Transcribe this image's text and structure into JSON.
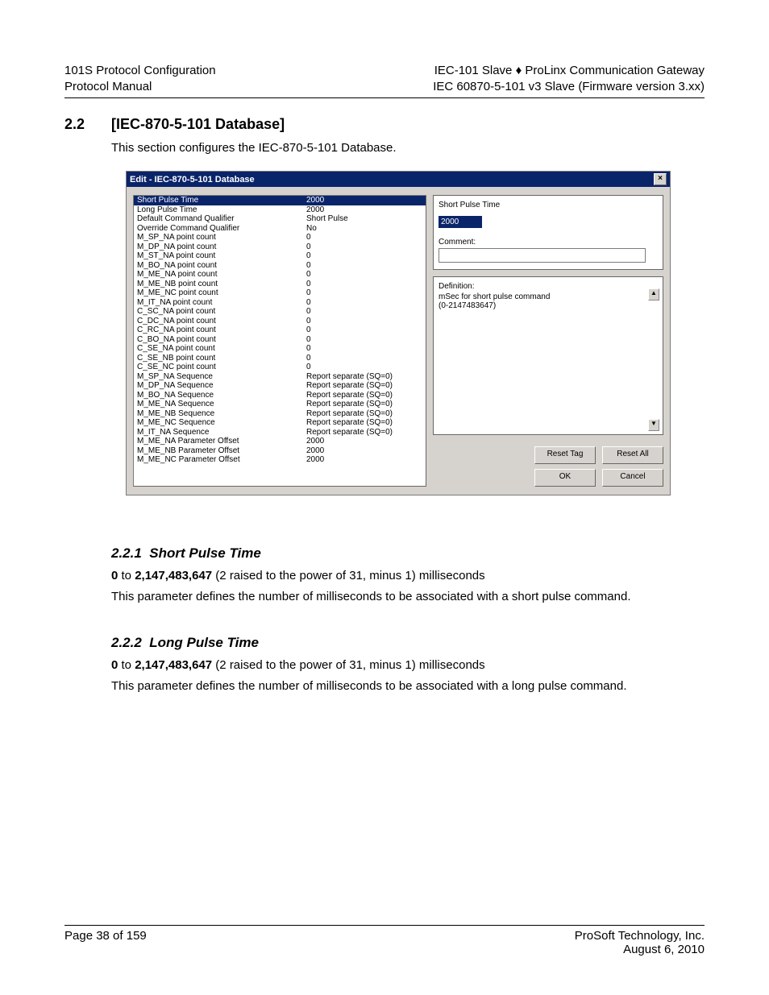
{
  "header": {
    "left1": "101S Protocol Configuration",
    "left2": "Protocol Manual",
    "right1": "IEC-101 Slave ♦ ProLinx Communication Gateway",
    "right2": "IEC 60870-5-101 v3 Slave   (Firmware version 3.xx)"
  },
  "section": {
    "num": "2.2",
    "title": "[IEC-870-5-101 Database]",
    "intro": "This section configures the IEC-870-5-101 Database."
  },
  "dialog": {
    "title": "Edit - IEC-870-5-101 Database",
    "close": "×",
    "rows": [
      {
        "k": "Short Pulse Time",
        "v": "2000",
        "sel": true
      },
      {
        "k": "Long Pulse Time",
        "v": "2000"
      },
      {
        "k": "Default Command Qualifier",
        "v": "Short Pulse"
      },
      {
        "k": "Override Command Qualifier",
        "v": "No"
      },
      {
        "k": "M_SP_NA point count",
        "v": "0"
      },
      {
        "k": "M_DP_NA point count",
        "v": "0"
      },
      {
        "k": "M_ST_NA point count",
        "v": "0"
      },
      {
        "k": "M_BO_NA point count",
        "v": "0"
      },
      {
        "k": "M_ME_NA point count",
        "v": "0"
      },
      {
        "k": "M_ME_NB point count",
        "v": "0"
      },
      {
        "k": "M_ME_NC point count",
        "v": "0"
      },
      {
        "k": "M_IT_NA point count",
        "v": "0"
      },
      {
        "k": "C_SC_NA point count",
        "v": "0"
      },
      {
        "k": "C_DC_NA point count",
        "v": "0"
      },
      {
        "k": "C_RC_NA point count",
        "v": "0"
      },
      {
        "k": "C_BO_NA point count",
        "v": "0"
      },
      {
        "k": "C_SE_NA point count",
        "v": "0"
      },
      {
        "k": "C_SE_NB point count",
        "v": "0"
      },
      {
        "k": "C_SE_NC point count",
        "v": "0"
      },
      {
        "k": "M_SP_NA Sequence",
        "v": "Report separate (SQ=0)"
      },
      {
        "k": "M_DP_NA Sequence",
        "v": "Report separate (SQ=0)"
      },
      {
        "k": "M_BO_NA Sequence",
        "v": "Report separate (SQ=0)"
      },
      {
        "k": "M_ME_NA Sequence",
        "v": "Report separate (SQ=0)"
      },
      {
        "k": "M_ME_NB Sequence",
        "v": "Report separate (SQ=0)"
      },
      {
        "k": "M_ME_NC Sequence",
        "v": "Report separate (SQ=0)"
      },
      {
        "k": "M_IT_NA Sequence",
        "v": "Report separate (SQ=0)"
      },
      {
        "k": "M_ME_NA Parameter Offset",
        "v": "2000"
      },
      {
        "k": "M_ME_NB Parameter Offset",
        "v": "2000"
      },
      {
        "k": "M_ME_NC Parameter Offset",
        "v": "2000"
      }
    ],
    "side": {
      "field_label": "Short Pulse Time",
      "field_value": "2000",
      "comment_label": "Comment:",
      "comment_value": "",
      "def_label": "Definition:",
      "def_text1": "mSec for short pulse command",
      "def_text2": "(0-2147483647)"
    },
    "buttons": {
      "reset_tag": "Reset Tag",
      "reset_all": "Reset All",
      "ok": "OK",
      "cancel": "Cancel"
    }
  },
  "sub1": {
    "num": "2.2.1",
    "title": "Short Pulse Time",
    "range_a": "0",
    "range_b": "2,147,483,647",
    "range_tail": " (2 raised to the power of 31, minus 1) milliseconds",
    "body": "This parameter defines the number of milliseconds to be associated with a short pulse command."
  },
  "sub2": {
    "num": "2.2.2",
    "title": "Long Pulse Time",
    "range_a": "0",
    "range_b": "2,147,483,647",
    "range_tail": " (2 raised to the power of 31, minus 1) milliseconds",
    "body": "This parameter defines the number of milliseconds to be associated with a long pulse command."
  },
  "footer": {
    "left": "Page 38 of 159",
    "right1": "ProSoft Technology, Inc.",
    "right2": "August 6, 2010"
  }
}
